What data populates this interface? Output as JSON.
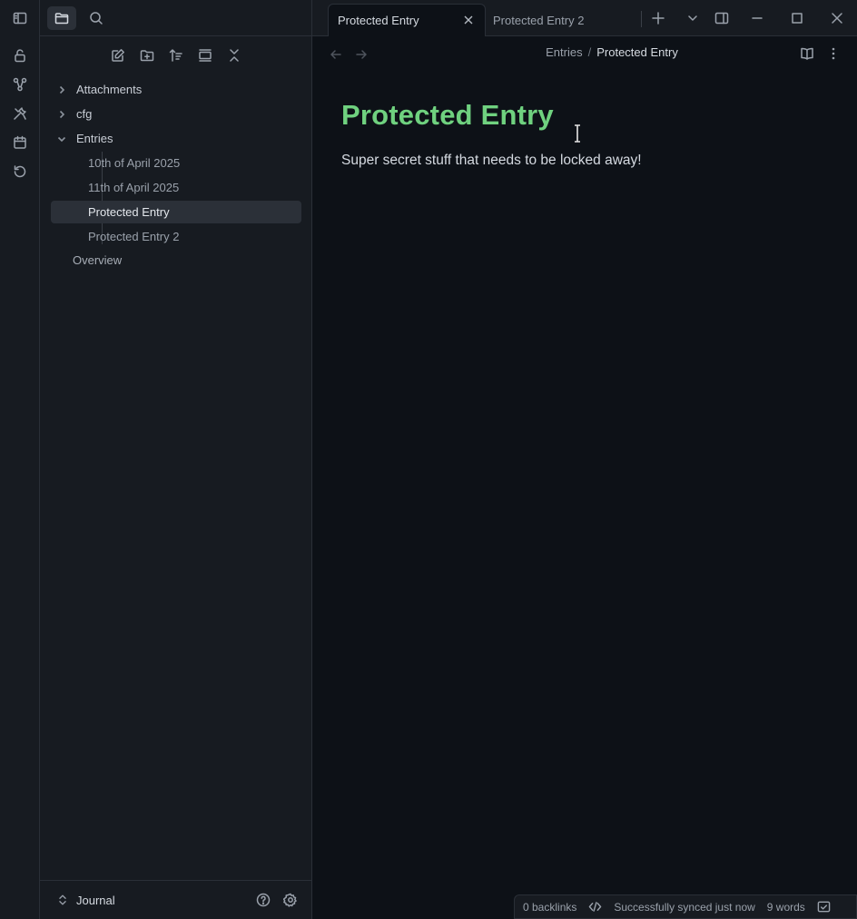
{
  "sidebar": {
    "tree": [
      {
        "label": "Attachments",
        "type": "folder",
        "expanded": false
      },
      {
        "label": "cfg",
        "type": "folder",
        "expanded": false
      },
      {
        "label": "Entries",
        "type": "folder",
        "expanded": true
      },
      {
        "label": "10th of April 2025",
        "type": "file"
      },
      {
        "label": "11th of April 2025",
        "type": "file"
      },
      {
        "label": "Protected Entry",
        "type": "file",
        "selected": true
      },
      {
        "label": "Protected Entry 2",
        "type": "file"
      },
      {
        "label": "Overview",
        "type": "file"
      }
    ],
    "vault_name": "Journal"
  },
  "tabs": [
    {
      "label": "Protected Entry",
      "active": true
    },
    {
      "label": "Protected Entry 2",
      "active": false
    }
  ],
  "editor": {
    "breadcrumb": {
      "parent": "Entries",
      "separator": "/",
      "current": "Protected Entry"
    },
    "title": "Protected Entry",
    "body": "Super secret stuff that needs to be locked away!"
  },
  "status": {
    "backlinks": "0 backlinks",
    "sync": "Successfully synced just now",
    "words": "9 words"
  },
  "colors": {
    "title": "#6fd17f",
    "background": "#0d1117",
    "panel": "#171b21"
  }
}
